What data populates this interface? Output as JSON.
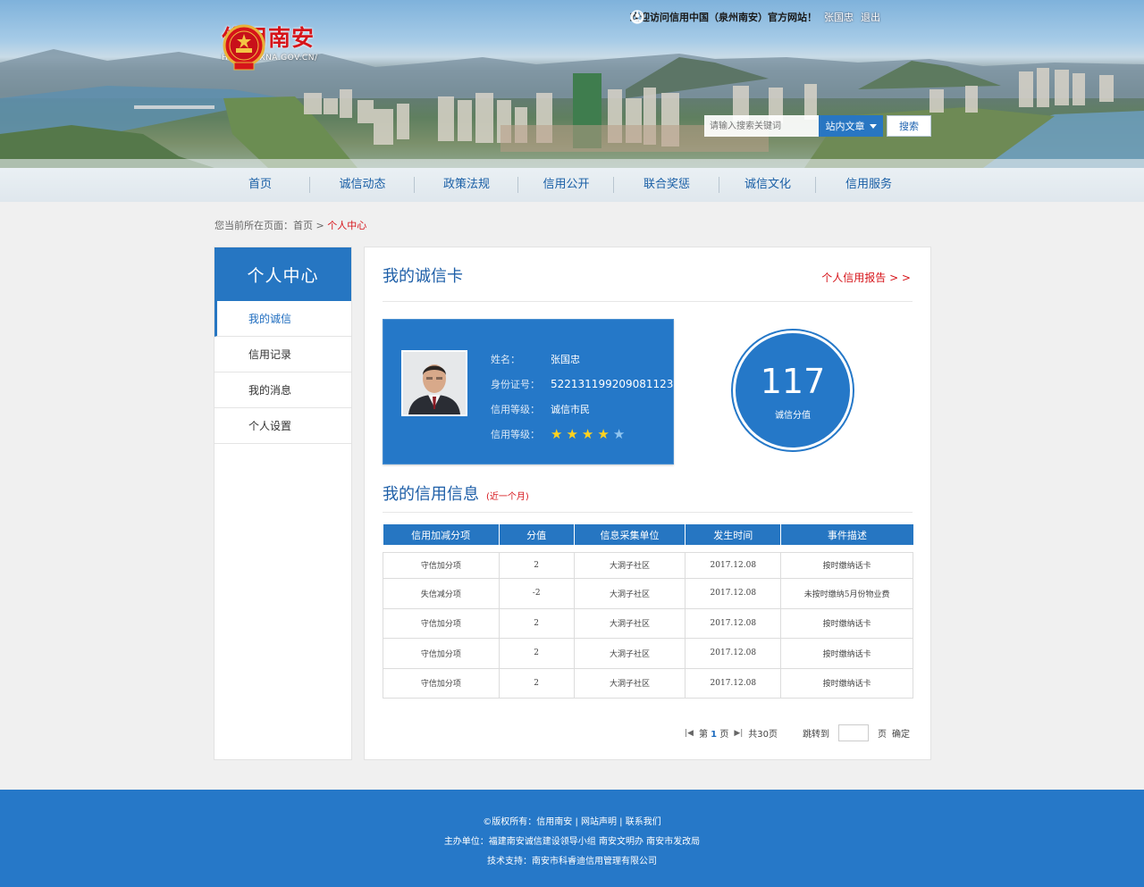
{
  "header": {
    "welcome": "欢迎访问信用中国（泉州南安）官方网站！",
    "username": "张国忠",
    "logout": "退出",
    "site_title": "信用南安",
    "site_url": "HTTP://CXNA.GOV.CN/",
    "search_placeholder": "请输入搜索关键词",
    "search_scope": "站内文章",
    "search_button": "搜索"
  },
  "nav": [
    "首页",
    "诚信动态",
    "政策法规",
    "信用公开",
    "联合奖惩",
    "诚信文化",
    "信用服务"
  ],
  "breadcrumb": {
    "prefix": "您当前所在页面：首页 >",
    "current": "个人中心"
  },
  "sidebar": {
    "title": "个人中心",
    "items": [
      "我的诚信",
      "信用记录",
      "我的消息",
      "个人设置"
    ]
  },
  "card_section": {
    "title": "我的诚信卡",
    "report_link": "个人信用报告 > >",
    "fields": [
      {
        "label": "姓名：",
        "value": "张国忠"
      },
      {
        "label": "身份证号：",
        "value": "522131199209081123"
      },
      {
        "label": "信用等级：",
        "value": "诚信市民"
      },
      {
        "label": "信用等级："
      }
    ],
    "stars": {
      "filled": 4,
      "total": 5,
      "filled_color": "#ffd21e",
      "empty_color": "#8fc4ef"
    },
    "score": {
      "value": "117",
      "label": "诚信分值"
    }
  },
  "info_section": {
    "title": "我的信用信息",
    "hint": "(近一个月)",
    "columns": [
      "信用加减分项",
      "分值",
      "信息采集单位",
      "发生时间",
      "事件描述"
    ],
    "rows": [
      [
        "守信加分项",
        "2",
        "大洞子社区",
        "2017.12.08",
        "按时缴纳话卡"
      ],
      [
        "失信减分项",
        "-2",
        "大洞子社区",
        "2017.12.08",
        "未按时缴纳5月份物业费"
      ],
      [
        "守信加分项",
        "2",
        "大洞子社区",
        "2017.12.08",
        "按时缴纳话卡"
      ],
      [
        "守信加分项",
        "2",
        "大洞子社区",
        "2017.12.08",
        "按时缴纳话卡"
      ],
      [
        "守信加分项",
        "2",
        "大洞子社区",
        "2017.12.08",
        "按时缴纳话卡"
      ]
    ]
  },
  "pager": {
    "prefix": "第",
    "page": "1",
    "suffix": "页",
    "total": "共30页",
    "jump": "跳转到",
    "page_unit": "页",
    "confirm": "确定"
  },
  "footer": {
    "line1": "©版权所有：信用南安 | 网站声明 | 联系我们",
    "line2": "主办单位：福建南安诚信建设领导小组 南安文明办 南安市发改局",
    "line3": "技术支持：南安市科睿迪信用管理有限公司"
  },
  "colors": {
    "primary": "#2676c2",
    "accent_red": "#d6141a",
    "footer_bg": "#2678c8"
  }
}
